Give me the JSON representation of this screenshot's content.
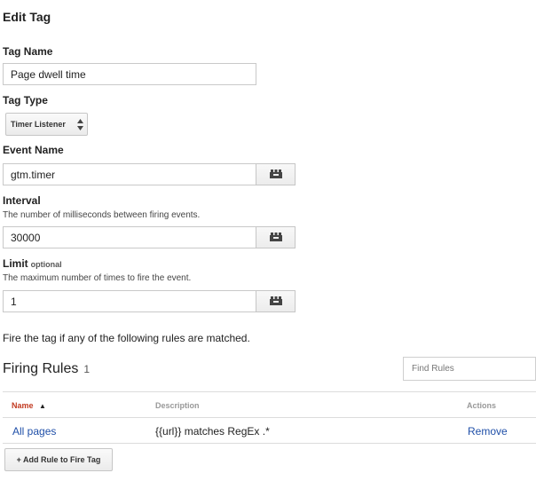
{
  "page": {
    "title": "Edit Tag"
  },
  "form": {
    "tag_name": {
      "label": "Tag Name",
      "value": "Page dwell time"
    },
    "tag_type": {
      "label": "Tag Type",
      "selected": "Timer Listener"
    },
    "event_name": {
      "label": "Event Name",
      "value": "gtm.timer"
    },
    "interval": {
      "label": "Interval",
      "help": "The number of milliseconds between firing events.",
      "value": "30000"
    },
    "limit": {
      "label": "Limit",
      "optional": "optional",
      "help": "The maximum number of times to fire the event.",
      "value": "1"
    }
  },
  "firing": {
    "intro": "Fire the tag if any of the following rules are matched.",
    "title": "Firing Rules",
    "count": "1",
    "search_placeholder": "Find Rules",
    "columns": {
      "name": "Name",
      "name_sort": "▲",
      "description": "Description",
      "actions": "Actions"
    },
    "rows": [
      {
        "name": "All pages",
        "description": "{{url}} matches RegEx .*",
        "action": "Remove"
      }
    ],
    "add_button": "+ Add Rule to Fire Tag"
  },
  "icons": {
    "variable": "macro-picker-icon",
    "select_arrows": "updown-arrows-icon",
    "sort": "sort-arrow-up-icon"
  },
  "colors": {
    "link": "#1f4fa8",
    "active_header": "#c23b22"
  }
}
